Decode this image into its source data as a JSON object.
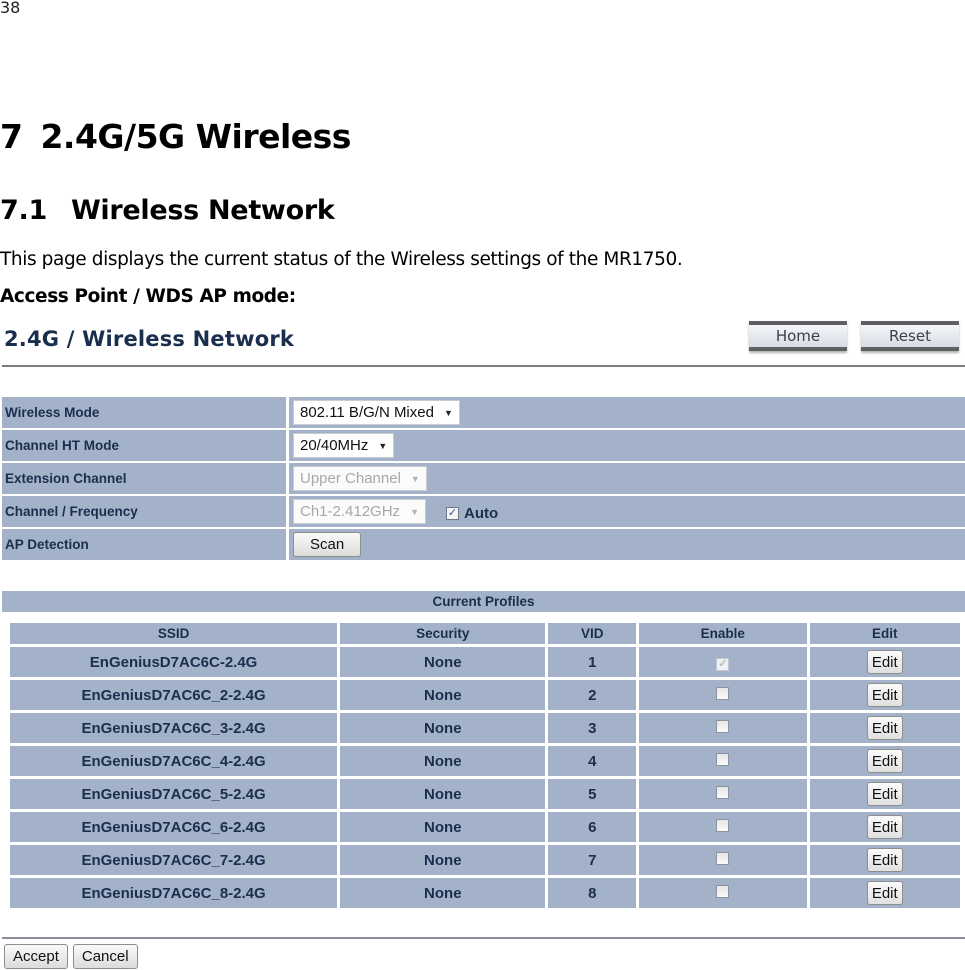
{
  "document": {
    "page_number": "38",
    "chapter_number": "7",
    "chapter_title": "2.4G/5G Wireless",
    "section_number": "7.1",
    "section_title": "Wireless Network",
    "description": "This page displays the current status of the Wireless settings of the MR1750.",
    "mode_label": "Access Point / WDS AP mode:"
  },
  "ui": {
    "title": "2.4G / Wireless Network",
    "home_label": "Home",
    "reset_label": "Reset",
    "settings": {
      "wireless_mode": {
        "label": "Wireless Mode",
        "value": "802.11 B/G/N Mixed"
      },
      "channel_ht_mode": {
        "label": "Channel HT Mode",
        "value": "20/40MHz"
      },
      "extension_channel": {
        "label": "Extension Channel",
        "value": "Upper Channel",
        "disabled": true
      },
      "channel_frequency": {
        "label": "Channel / Frequency",
        "value": "Ch1-2.412GHz",
        "disabled": true,
        "auto_label": "Auto",
        "auto_checked": true
      },
      "ap_detection": {
        "label": "AP Detection",
        "button_label": "Scan"
      }
    },
    "profiles": {
      "title": "Current Profiles",
      "columns": [
        "SSID",
        "Security",
        "VID",
        "Enable",
        "Edit"
      ],
      "edit_label": "Edit",
      "rows": [
        {
          "ssid": "EnGeniusD7AC6C-2.4G",
          "security": "None",
          "vid": "1",
          "enabled": true,
          "enable_disabled": true
        },
        {
          "ssid": "EnGeniusD7AC6C_2-2.4G",
          "security": "None",
          "vid": "2",
          "enabled": false
        },
        {
          "ssid": "EnGeniusD7AC6C_3-2.4G",
          "security": "None",
          "vid": "3",
          "enabled": false
        },
        {
          "ssid": "EnGeniusD7AC6C_4-2.4G",
          "security": "None",
          "vid": "4",
          "enabled": false
        },
        {
          "ssid": "EnGeniusD7AC6C_5-2.4G",
          "security": "None",
          "vid": "5",
          "enabled": false
        },
        {
          "ssid": "EnGeniusD7AC6C_6-2.4G",
          "security": "None",
          "vid": "6",
          "enabled": false
        },
        {
          "ssid": "EnGeniusD7AC6C_7-2.4G",
          "security": "None",
          "vid": "7",
          "enabled": false
        },
        {
          "ssid": "EnGeniusD7AC6C_8-2.4G",
          "security": "None",
          "vid": "8",
          "enabled": false
        }
      ]
    },
    "accept_label": "Accept",
    "cancel_label": "Cancel",
    "colors": {
      "row_bg": "#a3b2c8",
      "label_text": "#1a2e4d",
      "title_text": "#1a2e4d"
    }
  }
}
